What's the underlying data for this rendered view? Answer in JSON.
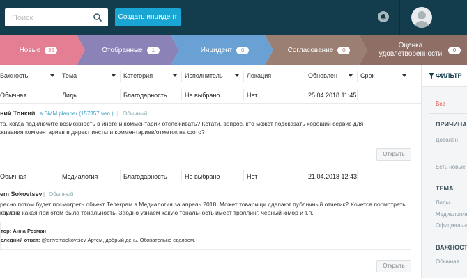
{
  "search": {
    "placeholder": "Поиск",
    "icon": "search-icon"
  },
  "header": {
    "create_button": "Создать инцидент"
  },
  "funnel": [
    {
      "label": "Новые",
      "count": "35",
      "color": "#e47e93"
    },
    {
      "label": "Отобранные",
      "count": "1",
      "color": "#8b83b8"
    },
    {
      "label": "Инцидент",
      "count": "0",
      "color": "#6aa1d4"
    },
    {
      "label": "Согласование",
      "count": "0",
      "color": "#9b7f72"
    },
    {
      "label": "Оценка удовлетворенности",
      "count": "0",
      "color": "#8e6e65"
    }
  ],
  "table": {
    "columns": [
      "Важность",
      "Тема",
      "Категория",
      "Исполнитель",
      "Локация",
      "Обновлен",
      "Срок"
    ],
    "rows": [
      [
        "Обычная",
        "Лиды",
        "Благодарность",
        "Не выбрано",
        "Нет",
        "25.04.2018 11:45"
      ],
      [
        "Обычная",
        "Медиалогия",
        "Благодарность",
        "Не выбрано",
        "Нет",
        "21.04.2018 12:43"
      ]
    ]
  },
  "posts": [
    {
      "author": "ний Тонкий",
      "source": "в SMM planner (157357 чел.)",
      "sep": "|",
      "level": "Обычный",
      "lines": [
        "та, когда подключите возможность в инсте и комментарии отслеживать?   Кстати, вопрос, кто может подсказать хороший сервис для",
        "живания комментариев в директ инсты и комментариев/отметок на фото?"
      ],
      "button": "Открыть"
    },
    {
      "author": "em Sokovtsev",
      "sep": "|",
      "level": "Обычный",
      "lines": [
        "ресно потом будет посмотреть объект Телеграм в Медиалогия за апрель 2018. Может товарищи сделают публичный отчетик? Хочется посмотреть как оно",
        "кнуло и какая при этом была тональность. Заодно узнаем какую тональность имеет троллинг, черный юмор и т.п."
      ],
      "reply_author_label": "тор:",
      "reply_author": "Анна Розман",
      "reply_last_label": "следний ответ:",
      "reply_last": "@artyemsokovtsev Артем, добрый день. Обязательно сделаем.",
      "button": "Открыть"
    }
  ],
  "sidebar": {
    "title": "ФИЛЬТР",
    "all": "Все",
    "reason_title": "ПРИЧИНА З",
    "reason_item": "Доволен",
    "new_any": "Есть новые с",
    "topic_title": "ТЕМА",
    "topics": [
      "Лиды",
      "Медиалогия",
      "Официальные"
    ],
    "importance_title": "ВАЖНОСТЬ",
    "importance_item": "Обычная"
  }
}
